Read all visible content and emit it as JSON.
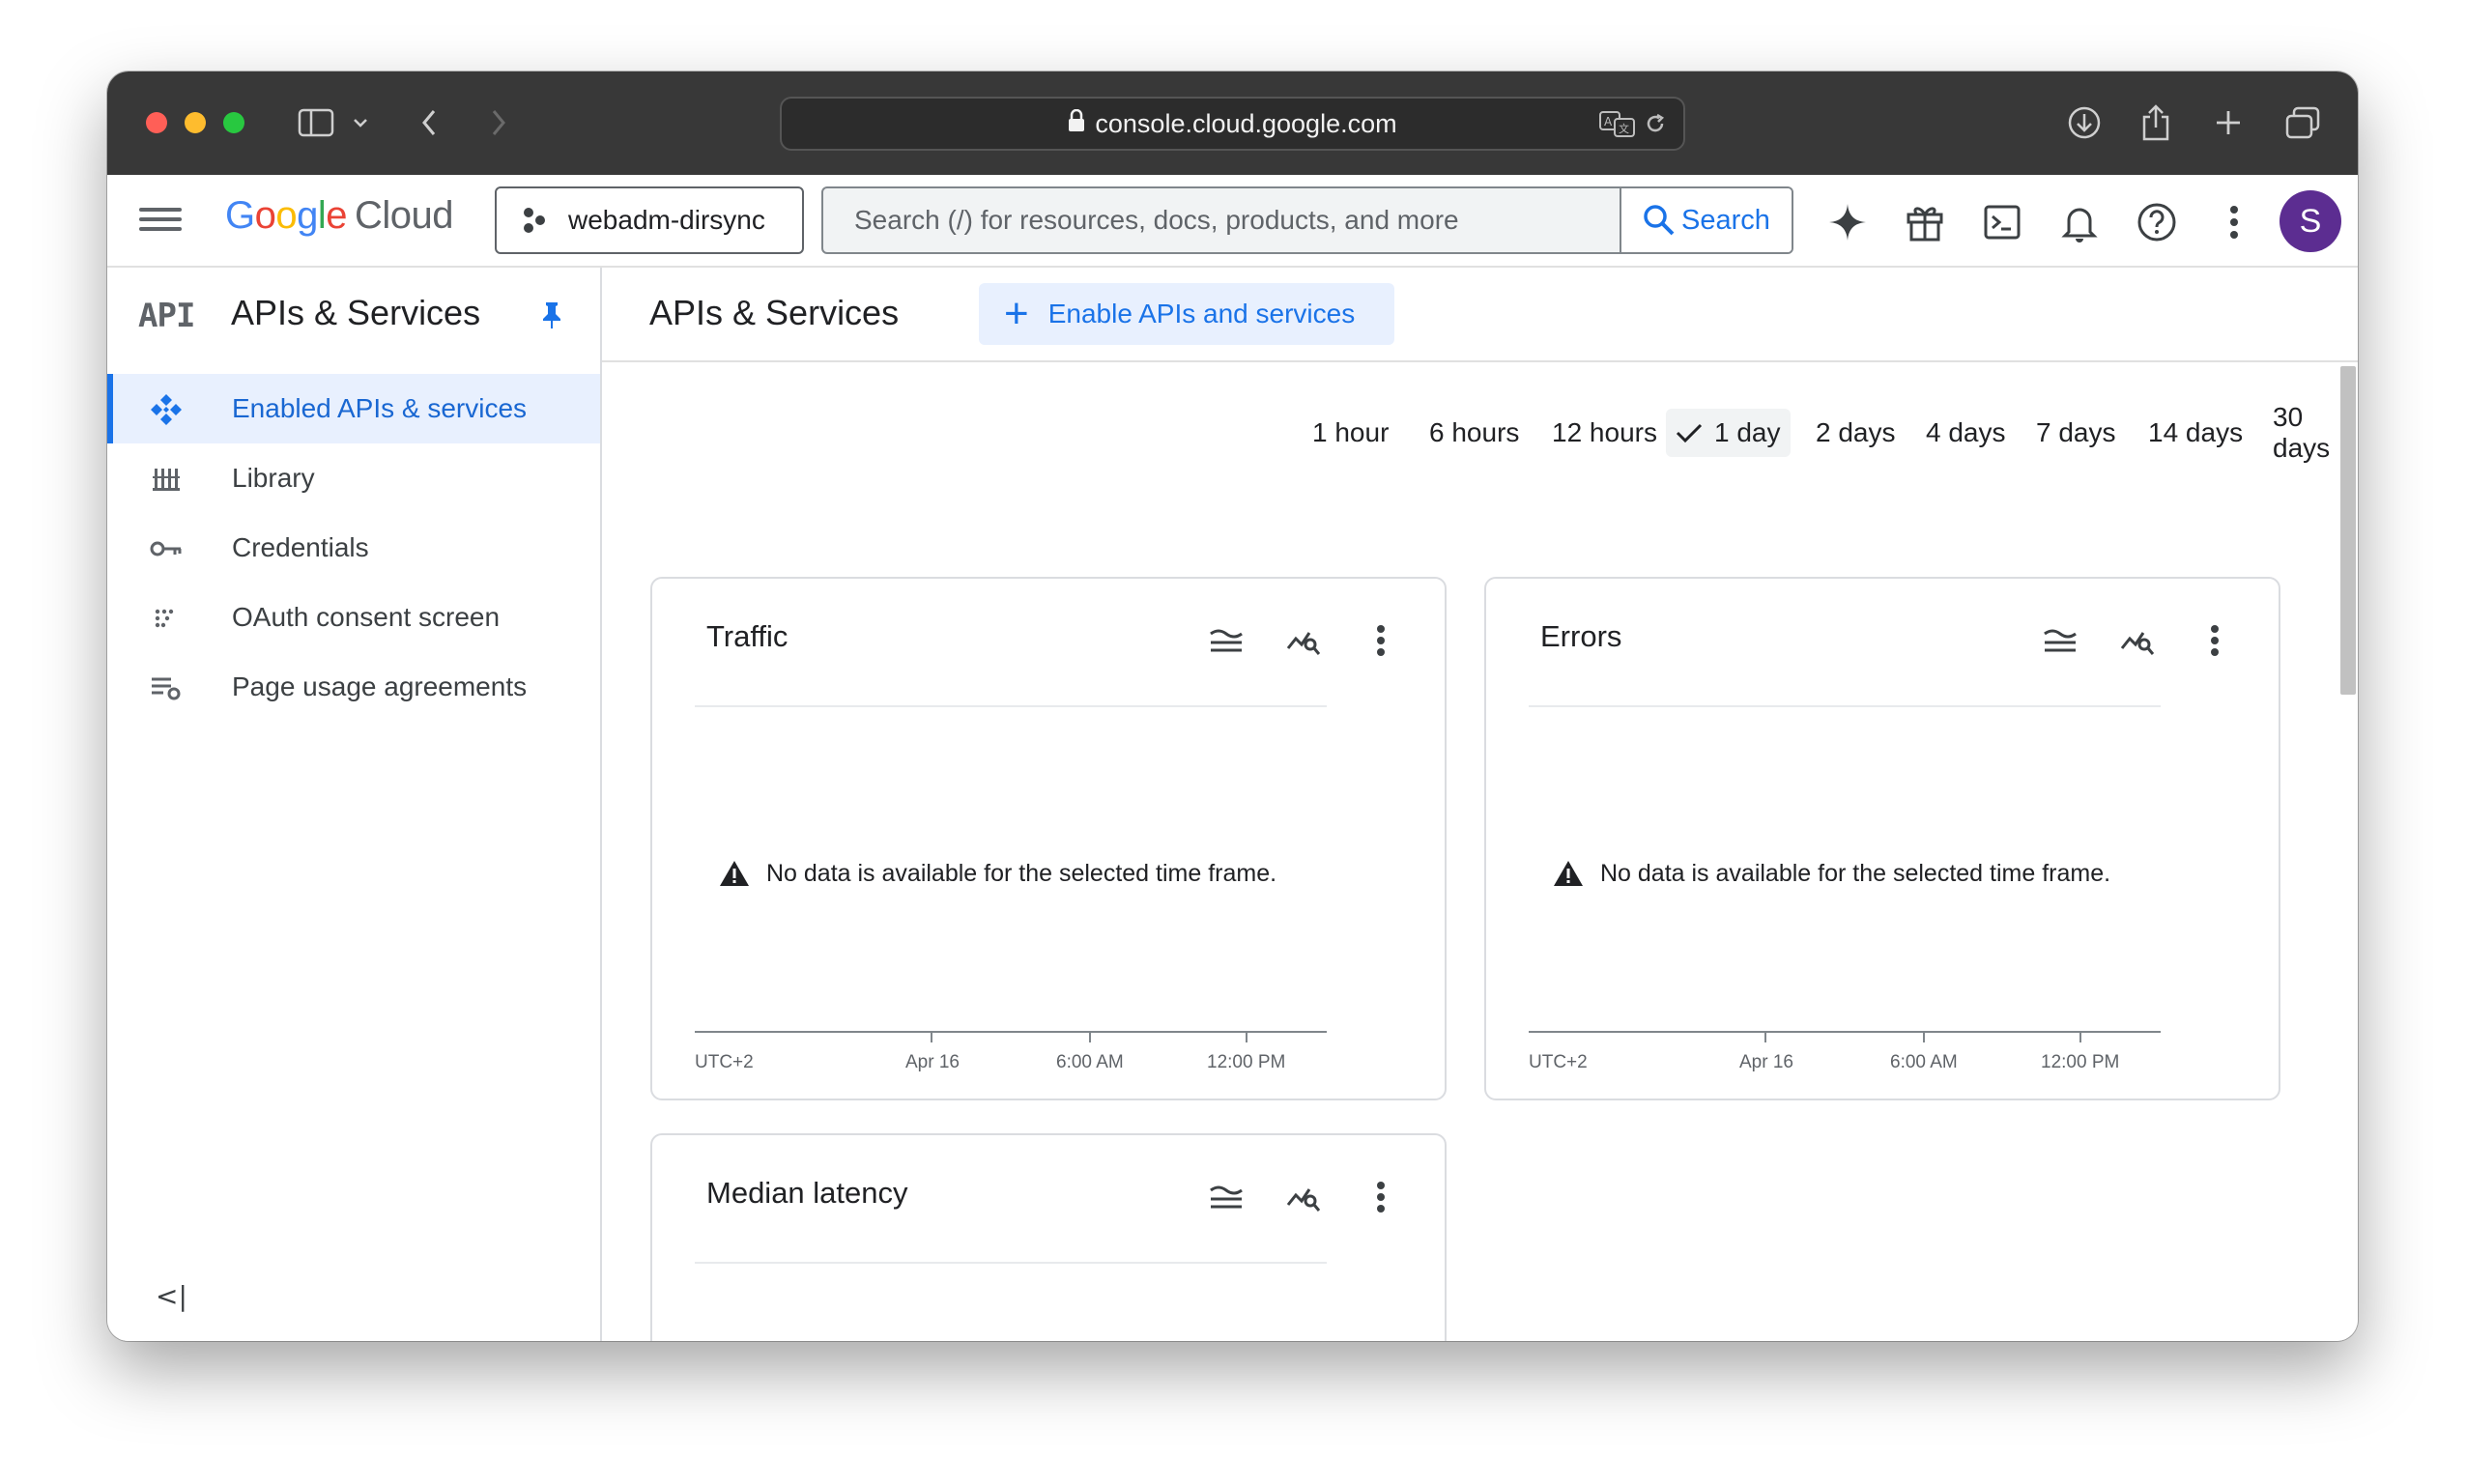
{
  "browser": {
    "url": "console.cloud.google.com"
  },
  "header": {
    "logo_google": "Google",
    "logo_cloud": "Cloud",
    "project": "webadm-dirsync",
    "search_placeholder": "Search (/) for resources, docs, products, and more",
    "search_button": "Search",
    "avatar_initial": "S",
    "brand_colors": [
      "#4285f4",
      "#ea4335",
      "#fbbc05",
      "#34a853"
    ]
  },
  "sidebar": {
    "badge": "API",
    "title": "APIs & Services",
    "items": [
      {
        "label": "Enabled APIs & services",
        "icon": "api-diamond-icon",
        "active": true
      },
      {
        "label": "Library",
        "icon": "library-icon",
        "active": false
      },
      {
        "label": "Credentials",
        "icon": "key-icon",
        "active": false
      },
      {
        "label": "OAuth consent screen",
        "icon": "oauth-dots-icon",
        "active": false
      },
      {
        "label": "Page usage agreements",
        "icon": "settings-list-icon",
        "active": false
      }
    ],
    "collapse_label": "<|"
  },
  "main": {
    "title": "APIs & Services",
    "enable_button": "Enable APIs and services",
    "time_ranges": [
      "1 hour",
      "6 hours",
      "12 hours",
      "1 day",
      "2 days",
      "4 days",
      "7 days",
      "14 days",
      "30 days"
    ],
    "selected_range": "1 day",
    "cards": [
      {
        "title": "Traffic",
        "message": "No data is available for the selected time frame.",
        "ticks": [
          "UTC+2",
          "Apr 16",
          "6:00 AM",
          "12:00 PM"
        ]
      },
      {
        "title": "Errors",
        "message": "No data is available for the selected time frame.",
        "ticks": [
          "UTC+2",
          "Apr 16",
          "6:00 AM",
          "12:00 PM"
        ]
      },
      {
        "title": "Median latency"
      }
    ]
  }
}
